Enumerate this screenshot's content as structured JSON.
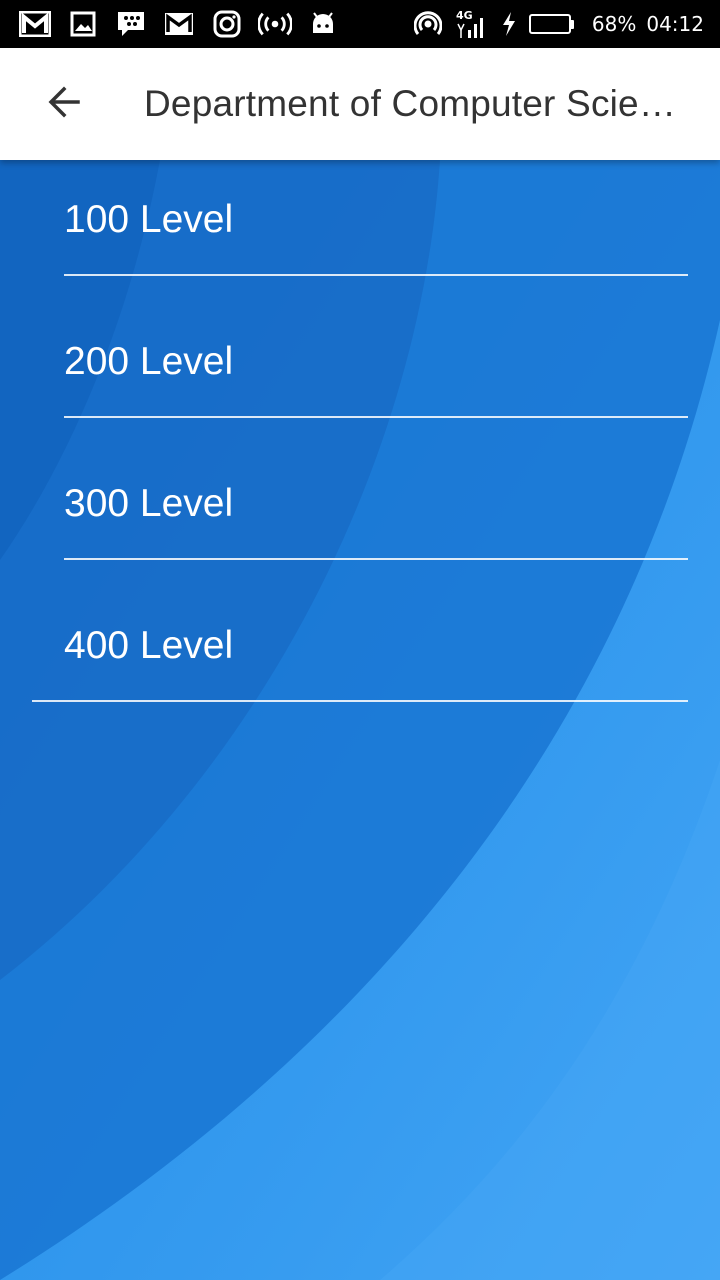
{
  "status_bar": {
    "icons_left": [
      "gmail-icon",
      "gallery-icon",
      "bbm-icon",
      "gmail-icon",
      "instagram-icon",
      "hotspot-icon",
      "android-debug-icon"
    ],
    "network_type": "4G",
    "battery_percent_text": "68%",
    "battery_level": 0.68,
    "time": "04:12"
  },
  "app_bar": {
    "back_icon": "arrow-back-icon",
    "title": "Department of Computer Science"
  },
  "levels": [
    {
      "label": "100 Level"
    },
    {
      "label": "200 Level"
    },
    {
      "label": "300 Level"
    },
    {
      "label": "400 Level"
    }
  ],
  "colors": {
    "app_bar_bg": "#ffffff",
    "title_color": "#333333",
    "background_blue": "#1e88e5",
    "text_on_blue": "#ffffff",
    "battery_fill": "#3ddc5a"
  }
}
